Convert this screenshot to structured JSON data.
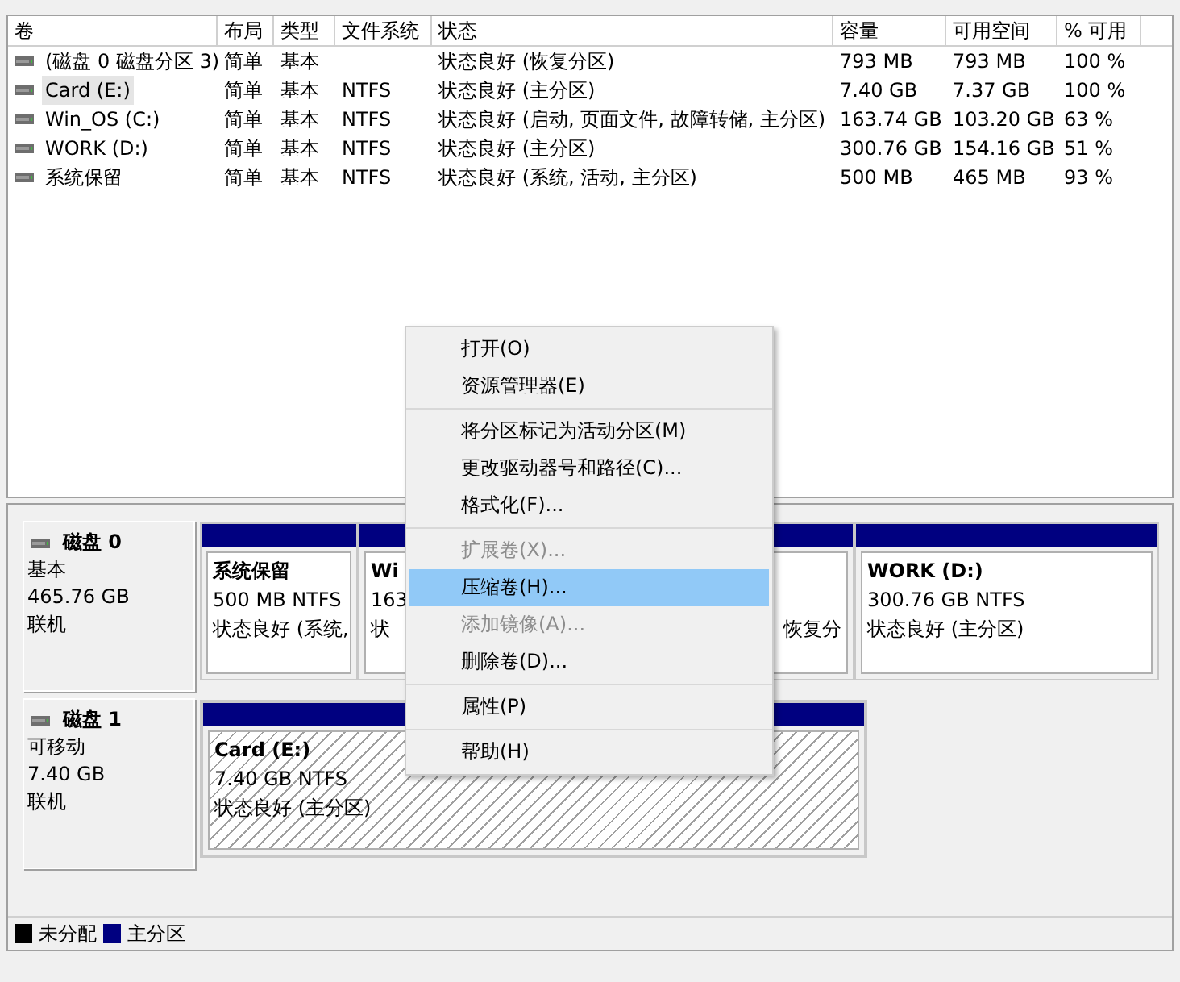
{
  "table": {
    "columns": [
      "卷",
      "布局",
      "类型",
      "文件系统",
      "状态",
      "容量",
      "可用空间",
      "% 可用"
    ],
    "rows": [
      {
        "selected": false,
        "cells": [
          "(磁盘 0 磁盘分区 3)",
          "简单",
          "基本",
          "",
          "状态良好 (恢复分区)",
          "793 MB",
          "793 MB",
          "100 %"
        ]
      },
      {
        "selected": true,
        "cells": [
          "Card (E:)",
          "简单",
          "基本",
          "NTFS",
          "状态良好 (主分区)",
          "7.40 GB",
          "7.37 GB",
          "100 %"
        ]
      },
      {
        "selected": false,
        "cells": [
          "Win_OS (C:)",
          "简单",
          "基本",
          "NTFS",
          "状态良好 (启动, 页面文件, 故障转储, 主分区)",
          "163.74 GB",
          "103.20 GB",
          "63 %"
        ]
      },
      {
        "selected": false,
        "cells": [
          "WORK (D:)",
          "简单",
          "基本",
          "NTFS",
          "状态良好 (主分区)",
          "300.76 GB",
          "154.16 GB",
          "51 %"
        ]
      },
      {
        "selected": false,
        "cells": [
          "系统保留",
          "简单",
          "基本",
          "NTFS",
          "状态良好 (系统, 活动, 主分区)",
          "500 MB",
          "465 MB",
          "93 %"
        ]
      }
    ]
  },
  "disks": [
    {
      "name": "磁盘 0",
      "type": "基本",
      "size": "465.76 GB",
      "status": "联机",
      "partitions": [
        {
          "selected": false,
          "name": "系统保留",
          "size": "500 MB NTFS",
          "status": "状态良好 (系统,"
        },
        {
          "selected": false,
          "name": "Wi",
          "size": "163",
          "status": "状"
        },
        {
          "selected": false,
          "status": "恢复分"
        },
        {
          "selected": false,
          "name": "WORK  (D:)",
          "size": "300.76 GB NTFS",
          "status": "状态良好 (主分区)"
        }
      ]
    },
    {
      "name": "磁盘 1",
      "type": "可移动",
      "size": "7.40 GB",
      "status": "联机",
      "partitions": [
        {
          "selected": true,
          "name": "Card  (E:)",
          "size": "7.40 GB NTFS",
          "status": "状态良好 (主分区)"
        }
      ]
    }
  ],
  "legend": [
    {
      "label": "未分配",
      "color": "#000000"
    },
    {
      "label": "主分区",
      "color": "#000080"
    }
  ],
  "context_menu": {
    "groups": [
      [
        {
          "label": "打开(O)",
          "disabled": false,
          "selected": false
        },
        {
          "label": "资源管理器(E)",
          "disabled": false,
          "selected": false
        }
      ],
      [
        {
          "label": "将分区标记为活动分区(M)",
          "disabled": false,
          "selected": false
        },
        {
          "label": "更改驱动器号和路径(C)...",
          "disabled": false,
          "selected": false
        },
        {
          "label": "格式化(F)...",
          "disabled": false,
          "selected": false
        }
      ],
      [
        {
          "label": "扩展卷(X)...",
          "disabled": true,
          "selected": false
        },
        {
          "label": "压缩卷(H)...",
          "disabled": false,
          "selected": true
        },
        {
          "label": "添加镜像(A)...",
          "disabled": true,
          "selected": false
        },
        {
          "label": "删除卷(D)...",
          "disabled": false,
          "selected": false
        }
      ],
      [
        {
          "label": "属性(P)",
          "disabled": false,
          "selected": false
        }
      ],
      [
        {
          "label": "帮助(H)",
          "disabled": false,
          "selected": false
        }
      ]
    ]
  }
}
